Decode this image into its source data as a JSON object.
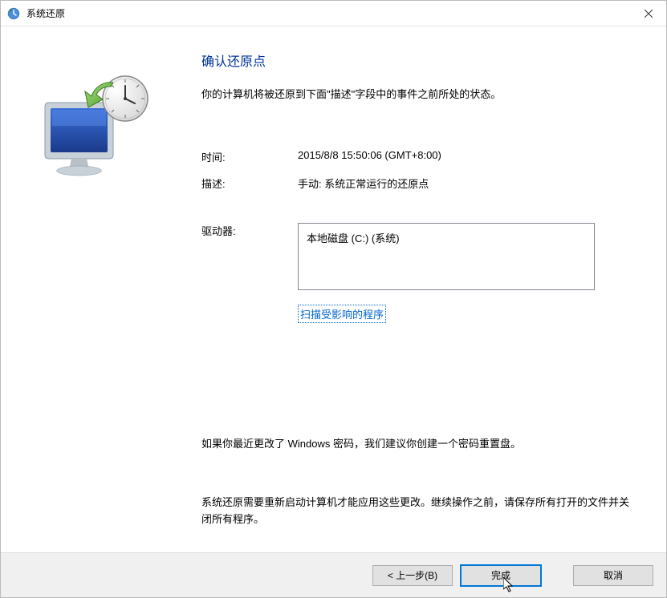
{
  "window": {
    "title": "系统还原"
  },
  "main": {
    "heading": "确认还原点",
    "subtitle": "你的计算机将被还原到下面\"描述\"字段中的事件之前所处的状态。",
    "fields": {
      "time_label": "时间:",
      "time_value": "2015/8/8 15:50:06 (GMT+8:00)",
      "desc_label": "描述:",
      "desc_value": "手动: 系统正常运行的还原点",
      "drives_label": "驱动器:",
      "drives_value": "本地磁盘 (C:) (系统)"
    },
    "scan_link": "扫描受影响的程序",
    "password_note": "如果你最近更改了 Windows 密码，我们建议你创建一个密码重置盘。",
    "restart_note": "系统还原需要重新启动计算机才能应用这些更改。继续操作之前，请保存所有打开的文件并关闭所有程序。"
  },
  "footer": {
    "back": "< 上一步(B)",
    "finish": "完成",
    "cancel": "取消"
  }
}
